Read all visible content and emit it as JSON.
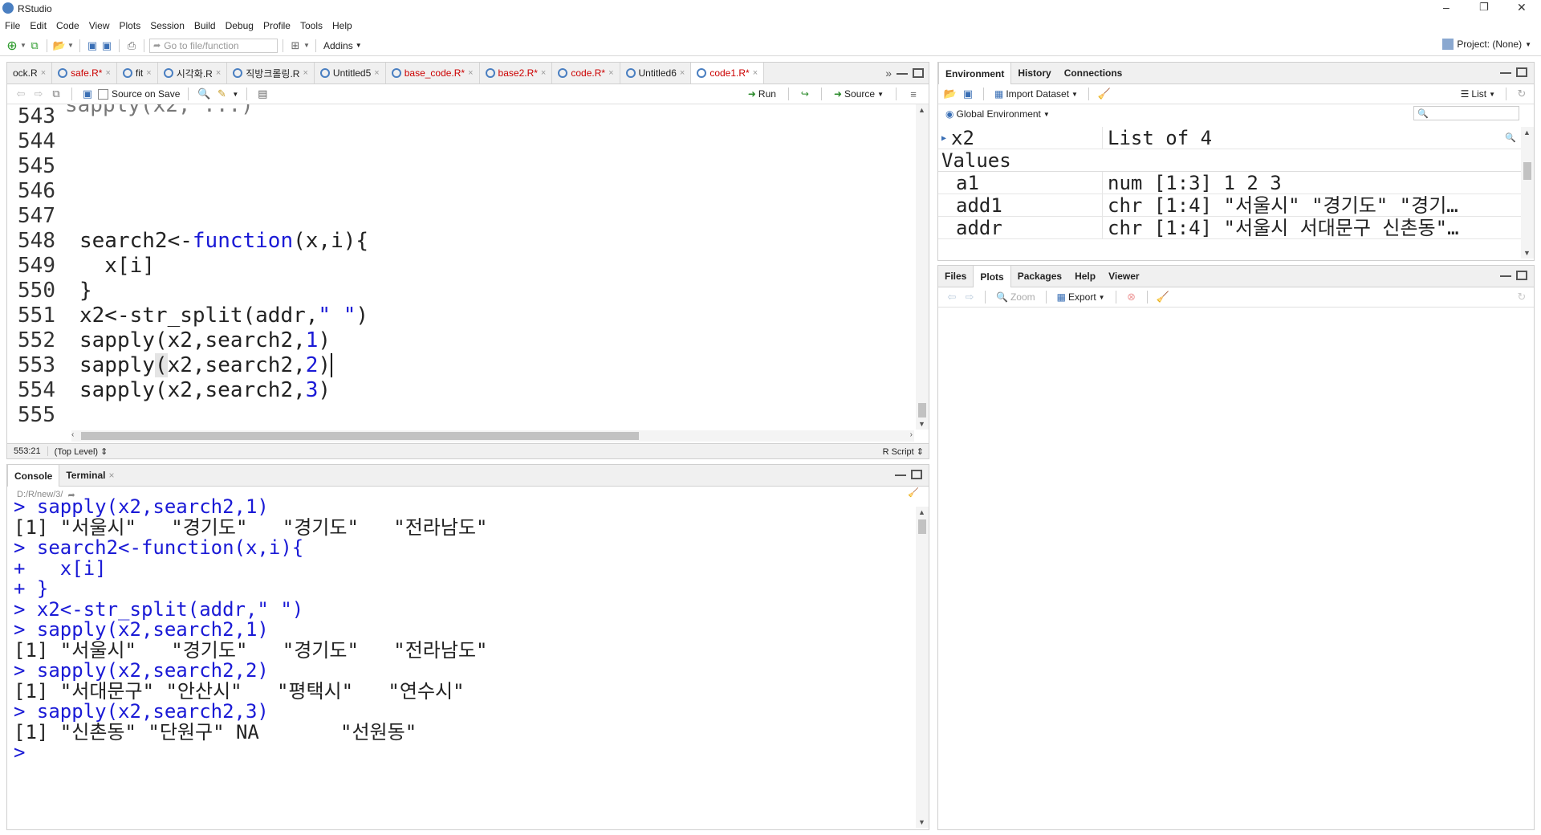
{
  "window": {
    "title": "RStudio",
    "min": "–",
    "max": "❐",
    "close": "✕"
  },
  "menu": [
    "File",
    "Edit",
    "Code",
    "View",
    "Plots",
    "Session",
    "Build",
    "Debug",
    "Profile",
    "Tools",
    "Help"
  ],
  "toolbar": {
    "goto_placeholder": "Go to file/function",
    "addins": "Addins",
    "project": "Project: (None)"
  },
  "editor": {
    "tabs": [
      {
        "label": "ock.R",
        "modified": false
      },
      {
        "label": "safe.R*",
        "modified": true
      },
      {
        "label": "fit",
        "modified": false
      },
      {
        "label": "시각화.R",
        "modified": false
      },
      {
        "label": "직방크롤링.R",
        "modified": false
      },
      {
        "label": "Untitled5",
        "modified": false
      },
      {
        "label": "base_code.R*",
        "modified": true
      },
      {
        "label": "base2.R*",
        "modified": true
      },
      {
        "label": "code.R*",
        "modified": true
      },
      {
        "label": "Untitled6",
        "modified": false
      },
      {
        "label": "code1.R*",
        "modified": true
      }
    ],
    "source_on_save": "Source on Save",
    "run": "Run",
    "source": "Source",
    "line_numbers": [
      "543",
      "544",
      "545",
      "546",
      "547",
      "548",
      "549",
      "550",
      "551",
      "552",
      "553",
      "554",
      "555"
    ],
    "status_pos": "553:21",
    "status_scope": "(Top Level)",
    "status_type": "R Script"
  },
  "console": {
    "tabs": [
      "Console",
      "Terminal"
    ],
    "path": "D:/R/new/3/",
    "lines": [
      {
        "t": "in",
        "s": "> sapply(x2,search2,1)"
      },
      {
        "t": "out",
        "s": "[1] \"서울시\"   \"경기도\"   \"경기도\"   \"전라남도\""
      },
      {
        "t": "in",
        "s": "> search2<-function(x,i){"
      },
      {
        "t": "in",
        "s": "+   x[i]"
      },
      {
        "t": "in",
        "s": "+ }"
      },
      {
        "t": "in",
        "s": "> x2<-str_split(addr,\" \")"
      },
      {
        "t": "in",
        "s": "> sapply(x2,search2,1)"
      },
      {
        "t": "out",
        "s": "[1] \"서울시\"   \"경기도\"   \"경기도\"   \"전라남도\""
      },
      {
        "t": "in",
        "s": "> sapply(x2,search2,2)"
      },
      {
        "t": "out",
        "s": "[1] \"서대문구\" \"안산시\"   \"평택시\"   \"연수시\""
      },
      {
        "t": "in",
        "s": "> sapply(x2,search2,3)"
      },
      {
        "t": "out",
        "s": "[1] \"신촌동\" \"단원구\" NA       \"선원동\""
      },
      {
        "t": "in",
        "s": "> "
      }
    ]
  },
  "env": {
    "tabs": [
      "Environment",
      "History",
      "Connections"
    ],
    "import": "Import Dataset",
    "list": "List",
    "scope": "Global Environment",
    "rows": [
      {
        "name": "x2",
        "value": "List of 4",
        "header": false,
        "expand": true
      },
      {
        "name": "Values",
        "value": "",
        "header": true,
        "expand": false
      },
      {
        "name": "a1",
        "value": "num [1:3] 1 2 3",
        "header": false,
        "expand": false
      },
      {
        "name": "add1",
        "value": "chr [1:4] \"서울시\" \"경기도\" \"경기…",
        "header": false,
        "expand": false
      },
      {
        "name": "addr",
        "value": "chr [1:4] \"서울시 서대문구 신촌동\"…",
        "header": false,
        "expand": false
      }
    ]
  },
  "files": {
    "tabs": [
      "Files",
      "Plots",
      "Packages",
      "Help",
      "Viewer"
    ],
    "zoom": "Zoom",
    "export": "Export"
  }
}
